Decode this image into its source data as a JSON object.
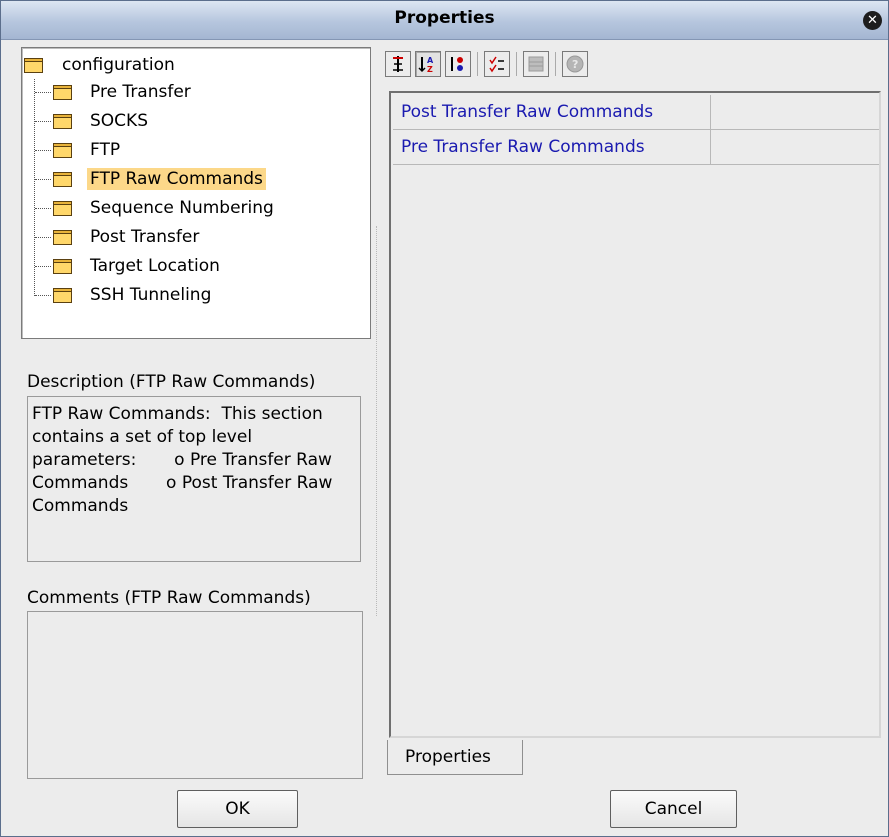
{
  "window": {
    "title": "Properties"
  },
  "tree": {
    "root": "configuration",
    "items": [
      "Pre Transfer",
      "SOCKS",
      "FTP",
      "FTP Raw Commands",
      "Sequence Numbering",
      "Post Transfer",
      "Target Location",
      "SSH Tunneling"
    ],
    "selected": "FTP Raw Commands"
  },
  "description": {
    "label": "Description (FTP Raw Commands)",
    "text": "FTP Raw Commands:  This section contains a set of top level parameters:       o Pre Transfer Raw Commands       o Post Transfer Raw Commands"
  },
  "comments": {
    "label": "Comments (FTP Raw Commands)",
    "text": ""
  },
  "toolbar": {
    "icons": [
      "category-sort-icon",
      "alpha-sort-icon",
      "group-sort-icon",
      "checklist-icon",
      "table-icon",
      "help-icon"
    ]
  },
  "properties": {
    "rows": [
      {
        "name": "Post Transfer Raw Commands",
        "value": ""
      },
      {
        "name": "Pre Transfer Raw Commands",
        "value": ""
      }
    ]
  },
  "tab": {
    "label": "Properties"
  },
  "buttons": {
    "ok": "OK",
    "cancel": "Cancel"
  },
  "colors": {
    "selection": "#fcd889",
    "property_name": "#1a1ab0",
    "folder": "#ffd76a"
  }
}
